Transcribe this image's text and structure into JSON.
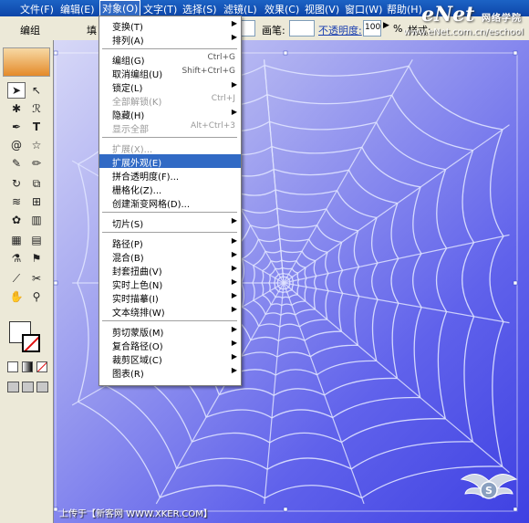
{
  "menubar": {
    "items": [
      {
        "label": "文件(F)"
      },
      {
        "label": "编辑(E)"
      },
      {
        "label": "对象(O)"
      },
      {
        "label": "文字(T)"
      },
      {
        "label": "选择(S)"
      },
      {
        "label": "滤镜(L)"
      },
      {
        "label": "效果(C)"
      },
      {
        "label": "视图(V)"
      },
      {
        "label": "窗口(W)"
      },
      {
        "label": "帮助(H)"
      }
    ]
  },
  "options_bar": {
    "group_label": "编组",
    "fill_label": "填",
    "brush_label": "画笔:",
    "opacity_label": "不透明度:",
    "opacity_value": "100",
    "percent": "%",
    "style_label": "样式:"
  },
  "logo": {
    "text": "eNet",
    "cn": "网络学院",
    "url": "www.eNet.com.cn/eschool"
  },
  "object_menu": {
    "items": [
      {
        "label": "变换(T)",
        "shortcut": "",
        "submenu": true,
        "disabled": false
      },
      {
        "label": "排列(A)",
        "shortcut": "",
        "submenu": true,
        "disabled": false
      },
      {
        "sep": true
      },
      {
        "label": "编组(G)",
        "shortcut": "Ctrl+G",
        "submenu": false,
        "disabled": false
      },
      {
        "label": "取消编组(U)",
        "shortcut": "Shift+Ctrl+G",
        "submenu": false,
        "disabled": false
      },
      {
        "label": "锁定(L)",
        "shortcut": "",
        "submenu": true,
        "disabled": false
      },
      {
        "label": "全部解锁(K)",
        "shortcut": "Ctrl+J",
        "submenu": false,
        "disabled": true
      },
      {
        "label": "隐藏(H)",
        "shortcut": "",
        "submenu": true,
        "disabled": false
      },
      {
        "label": "显示全部",
        "shortcut": "Alt+Ctrl+3",
        "submenu": false,
        "disabled": true
      },
      {
        "sep": true
      },
      {
        "label": "扩展(X)...",
        "shortcut": "",
        "submenu": false,
        "disabled": true
      },
      {
        "label": "扩展外观(E)",
        "shortcut": "",
        "submenu": false,
        "disabled": false,
        "highlight": true
      },
      {
        "label": "拼合透明度(F)...",
        "shortcut": "",
        "submenu": false,
        "disabled": false
      },
      {
        "label": "栅格化(Z)...",
        "shortcut": "",
        "submenu": false,
        "disabled": false
      },
      {
        "label": "创建渐变网格(D)...",
        "shortcut": "",
        "submenu": false,
        "disabled": false
      },
      {
        "sep": true
      },
      {
        "label": "切片(S)",
        "shortcut": "",
        "submenu": true,
        "disabled": false
      },
      {
        "sep": true
      },
      {
        "label": "路径(P)",
        "shortcut": "",
        "submenu": true,
        "disabled": false
      },
      {
        "label": "混合(B)",
        "shortcut": "",
        "submenu": true,
        "disabled": false
      },
      {
        "label": "封套扭曲(V)",
        "shortcut": "",
        "submenu": true,
        "disabled": false
      },
      {
        "label": "实时上色(N)",
        "shortcut": "",
        "submenu": true,
        "disabled": false
      },
      {
        "label": "实时描摹(I)",
        "shortcut": "",
        "submenu": true,
        "disabled": false
      },
      {
        "label": "文本绕排(W)",
        "shortcut": "",
        "submenu": true,
        "disabled": false
      },
      {
        "sep": true
      },
      {
        "label": "剪切蒙版(M)",
        "shortcut": "",
        "submenu": true,
        "disabled": false
      },
      {
        "label": "复合路径(O)",
        "shortcut": "",
        "submenu": true,
        "disabled": false
      },
      {
        "label": "裁剪区域(C)",
        "shortcut": "",
        "submenu": true,
        "disabled": false
      },
      {
        "label": "图表(R)",
        "shortcut": "",
        "submenu": true,
        "disabled": false
      }
    ]
  },
  "watermark": {
    "left_text": "上传于【新客网 WWW.XKER.COM】",
    "badge_text": "S"
  },
  "colors": {
    "menubar": "#0d45a8",
    "highlight": "#316ac5",
    "canvas_light": "#d7d8f7",
    "canvas_dark": "#3e40e2",
    "web_line": "#dfe3ff"
  }
}
